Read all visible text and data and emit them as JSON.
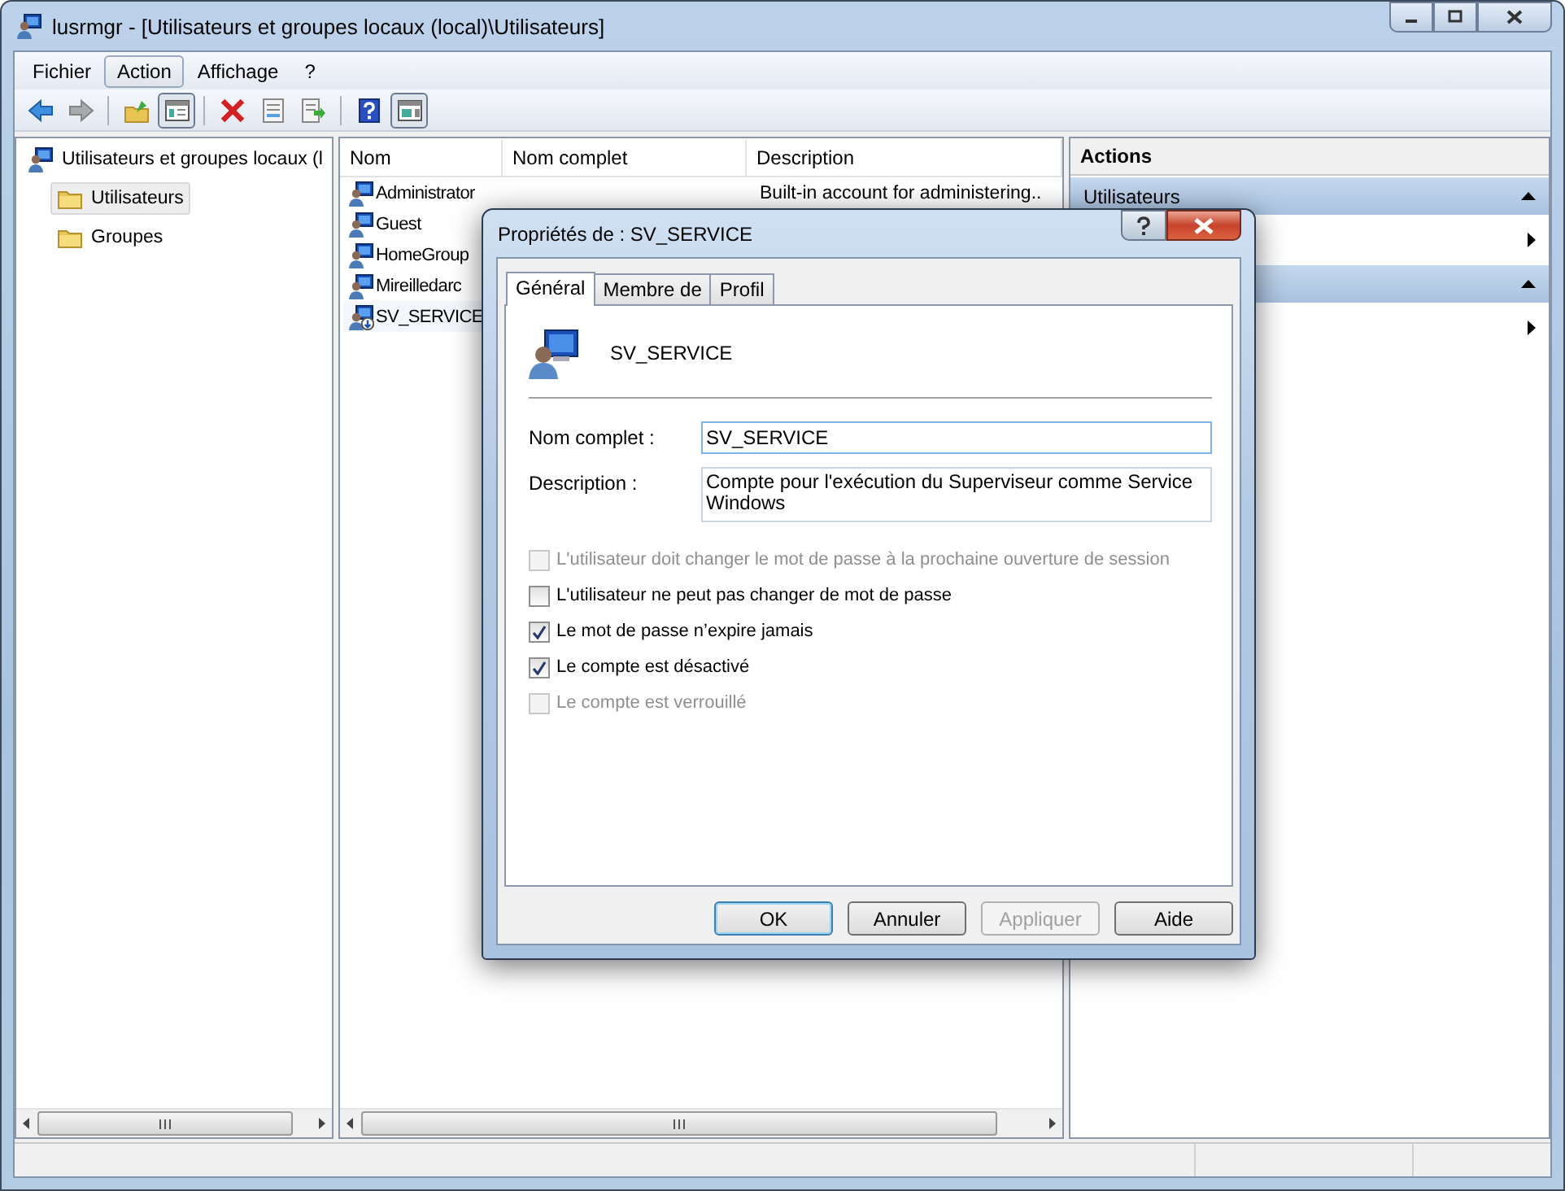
{
  "window": {
    "title": "lusrmgr - [Utilisateurs et groupes locaux (local)\\Utilisateurs]"
  },
  "menu": [
    {
      "label": "Fichier",
      "selected": false
    },
    {
      "label": "Action",
      "selected": true
    },
    {
      "label": "Affichage",
      "selected": false
    },
    {
      "label": "?",
      "selected": false
    }
  ],
  "toolbar": [
    {
      "kind": "back",
      "disabled": false,
      "on": false
    },
    {
      "kind": "forward",
      "disabled": true,
      "on": false
    },
    {
      "kind": "sep"
    },
    {
      "kind": "up",
      "disabled": false,
      "on": false
    },
    {
      "kind": "tree",
      "disabled": false,
      "on": true
    },
    {
      "kind": "sep"
    },
    {
      "kind": "delete",
      "disabled": false,
      "on": false
    },
    {
      "kind": "properties",
      "disabled": false,
      "on": false
    },
    {
      "kind": "export",
      "disabled": false,
      "on": false
    },
    {
      "kind": "sep"
    },
    {
      "kind": "help",
      "disabled": false,
      "on": false
    },
    {
      "kind": "actionpane",
      "disabled": false,
      "on": true
    }
  ],
  "tree": [
    {
      "label": "Utilisateurs et groupes locaux (l",
      "kind": "computer",
      "selected": false,
      "children": [
        {
          "label": "Utilisateurs",
          "kind": "folder",
          "selected": true
        },
        {
          "label": "Groupes",
          "kind": "folder",
          "selected": false
        }
      ]
    }
  ],
  "list": {
    "columns": [
      "Nom",
      "Nom complet",
      "Description"
    ],
    "rows": [
      {
        "name": "Administrator",
        "description": "Built-in account for administering..",
        "disabled": false,
        "selected": false
      },
      {
        "name": "Guest",
        "disabled": false,
        "selected": false
      },
      {
        "name": "HomeGroup",
        "disabled": false,
        "selected": false
      },
      {
        "name": "Mireilledarc",
        "disabled": false,
        "selected": false
      },
      {
        "name": "SV_SERVICE",
        "disabled": true,
        "selected": true
      }
    ]
  },
  "actions": {
    "title": "Actions",
    "sections": [
      {
        "title": "Utilisateurs",
        "expanded": true,
        "entries": [
          {
            "kind": "submenu"
          }
        ]
      },
      {
        "expanded": true,
        "entries": [
          {
            "kind": "submenu"
          }
        ]
      }
    ]
  },
  "dialog": {
    "title": "Propriétés de : SV_SERVICE",
    "tabs": [
      {
        "label": "Général",
        "selected": true
      },
      {
        "label": "Membre de",
        "selected": false
      },
      {
        "label": "Profil",
        "selected": false
      }
    ],
    "user": "SV_SERVICE",
    "fields": [
      {
        "label": "Nom complet :",
        "value": "SV_SERVICE",
        "kind": "input"
      },
      {
        "label": "Description :",
        "value": "Compte pour l'exécution du Superviseur comme Service Windows",
        "kind": "textarea"
      }
    ],
    "checkboxes": [
      {
        "label": "L'utilisateur doit changer le mot de passe à la prochaine ouverture de session",
        "checked": false,
        "disabled": true
      },
      {
        "label": "L'utilisateur ne peut pas changer de mot de passe",
        "checked": false,
        "disabled": false
      },
      {
        "label": "Le mot de passe n’expire jamais",
        "checked": true,
        "disabled": false
      },
      {
        "label": "Le compte est désactivé",
        "checked": true,
        "disabled": false
      },
      {
        "label": "Le compte est verrouillé",
        "checked": false,
        "disabled": true
      }
    ],
    "buttons": [
      {
        "label": "OK",
        "default": true,
        "disabled": false
      },
      {
        "label": "Annuler",
        "default": false,
        "disabled": false
      },
      {
        "label": "Appliquer",
        "default": false,
        "disabled": true
      },
      {
        "label": "Aide",
        "default": false,
        "disabled": false
      }
    ]
  }
}
